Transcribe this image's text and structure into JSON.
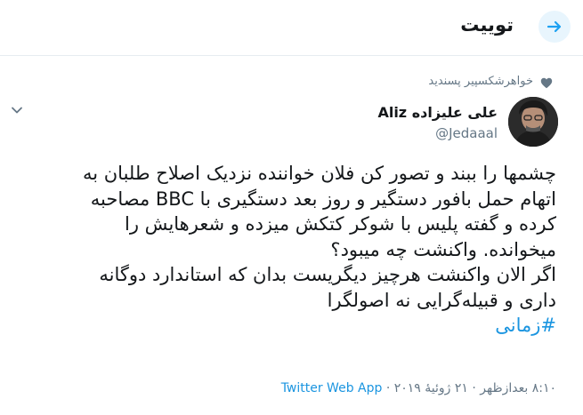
{
  "header": {
    "title": "توییت",
    "back_icon": "arrow-right-icon",
    "accent": "#1da1f2"
  },
  "tweet": {
    "social_context": "خواهرشکسپیر پسندید",
    "author": {
      "name": "علی علیزاده Aliz",
      "handle": "@Jedaaal"
    },
    "text_lines": [
      "چشمها را ببند و تصور کن فلان خواننده نزدیک اصلاح طلبان به",
      "اتهام حمل بافور دستگیر و روز بعد دستگیری با BBC مصاحبه",
      "کرده و گفته پلیس با شوکر کتکش میزده و شعرهایش را",
      "میخوانده. واکنشت چه میبود؟",
      "اگر الان واکنشت هرچیز دیگریست بدان که استاندارد دوگانه",
      "داری و قبیله‌گرایی نه اصولگرا"
    ],
    "hashtag": "#زمانی",
    "timestamp": "۸:۱۰ بعدازظهر · ۲۱ ژوئیهٔ ۲۰۱۹ · ",
    "source": "Twitter Web App"
  },
  "colors": {
    "link": "#1b95e0",
    "secondary_text": "#657786",
    "divider": "#e6ecf0"
  }
}
